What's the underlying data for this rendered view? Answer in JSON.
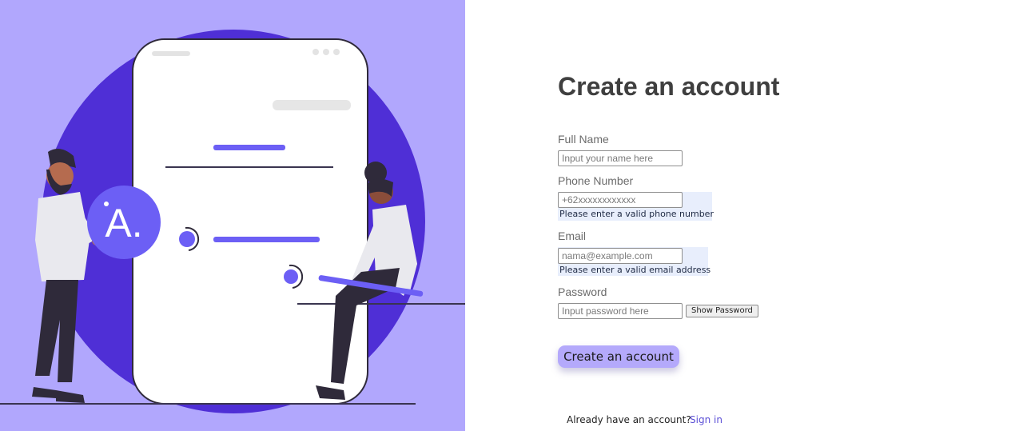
{
  "illustration": {
    "logo_letter": "A.",
    "colors": {
      "background": "#b1a7fd",
      "circle": "#4f2fd6",
      "accent": "#6c5ff5",
      "phone": "#ffffff",
      "dark": "#2f2a3a"
    }
  },
  "form": {
    "title": "Create an account",
    "full_name": {
      "label": "Full Name",
      "placeholder": "Input your name here"
    },
    "phone": {
      "label": "Phone Number",
      "placeholder": "+62xxxxxxxxxxxx",
      "hint": "Please enter a valid phone number"
    },
    "email": {
      "label": "Email",
      "placeholder": "nama@example.com",
      "hint": "Please enter a valid email address"
    },
    "password": {
      "label": "Password",
      "placeholder": "Input password here",
      "toggle_label": "Show Password"
    },
    "submit_label": "Create an account",
    "footer": {
      "prompt": "Already have an account?",
      "link": "Sign in"
    }
  }
}
